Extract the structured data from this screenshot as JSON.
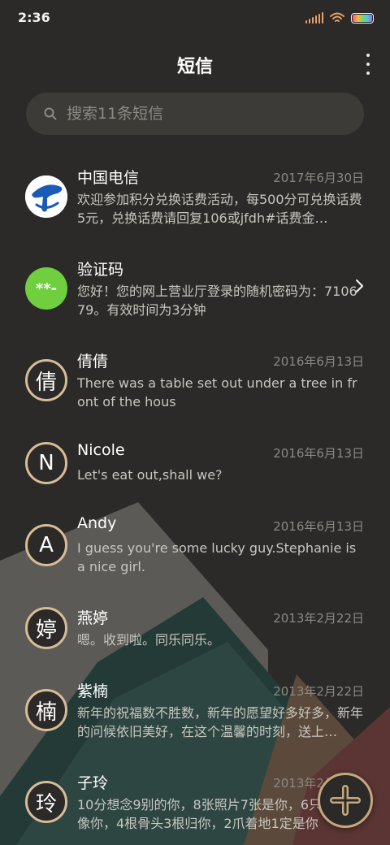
{
  "status_bar": {
    "time": "2:36",
    "accent_color": "#e8a06a"
  },
  "header": {
    "title": "短信",
    "more_icon": "more-vertical-icon"
  },
  "search": {
    "placeholder": "搜索11条短信",
    "icon": "search-icon"
  },
  "conversations": [
    {
      "sender": "中国电信",
      "date": "2017年6月30日",
      "preview": "欢迎参加积分兑换话费活动，每500分可兑换话费5元，兑换话费请回复106或jfdh#话费金…",
      "avatar_type": "china-telecom-logo"
    },
    {
      "sender": "验证码",
      "date": "",
      "preview": "您好！您的网上营业厅登录的随机密码为：710679。有效时间为3分钟",
      "avatar_text": "**-",
      "avatar_color": "#6fcf3f"
    },
    {
      "sender": "倩倩",
      "date": "2016年6月13日",
      "preview": "There was a table set out under a tree in front of the hous",
      "avatar_text": "倩"
    },
    {
      "sender": "Nicole",
      "date": "2016年6月13日",
      "preview": "Let's eat out,shall we?",
      "avatar_text": "N"
    },
    {
      "sender": "Andy",
      "date": "2016年6月13日",
      "preview": "I guess you're some lucky guy.Stephanie is a nice girl.",
      "avatar_text": "A"
    },
    {
      "sender": "燕婷",
      "date": "2013年2月22日",
      "preview": "嗯。收到啦。同乐同乐。",
      "avatar_text": "婷"
    },
    {
      "sender": "紫楠",
      "date": "2013年2月22日",
      "preview": "新年的祝福数不胜数，新年的愿望好多好多，新年的问候依旧美好，在这个温馨的时刻，送上…",
      "avatar_text": "楠"
    },
    {
      "sender": "子玲",
      "date": "2013年2月22日",
      "preview": "10分想念9别的你，8张照片7张是你，6只眼睛只像你，4根骨头3根归你，2爪着地1定是你",
      "avatar_text": "玲"
    }
  ],
  "fab": {
    "icon": "plus-icon",
    "border_color": "#c6a77d"
  }
}
